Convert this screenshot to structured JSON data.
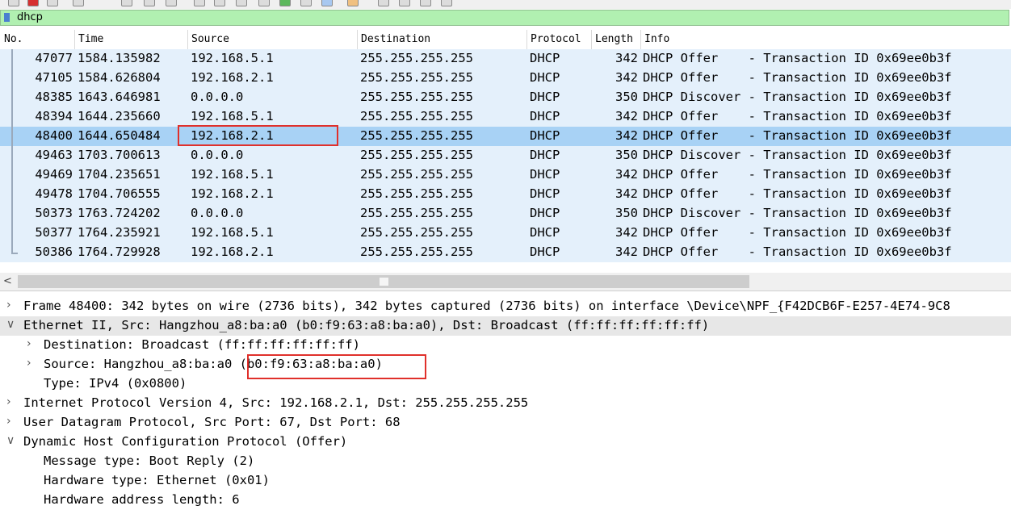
{
  "filter": {
    "value": "dhcp"
  },
  "columns": [
    "No.",
    "Time",
    "Source",
    "Destination",
    "Protocol",
    "Length",
    "Info"
  ],
  "packets": [
    {
      "no": "47077",
      "time": "1584.135982",
      "src": "192.168.5.1",
      "dst": "255.255.255.255",
      "proto": "DHCP",
      "len": "342",
      "info": "DHCP Offer    - Transaction ID 0x69ee0b3f"
    },
    {
      "no": "47105",
      "time": "1584.626804",
      "src": "192.168.2.1",
      "dst": "255.255.255.255",
      "proto": "DHCP",
      "len": "342",
      "info": "DHCP Offer    - Transaction ID 0x69ee0b3f"
    },
    {
      "no": "48385",
      "time": "1643.646981",
      "src": "0.0.0.0",
      "dst": "255.255.255.255",
      "proto": "DHCP",
      "len": "350",
      "info": "DHCP Discover - Transaction ID 0x69ee0b3f"
    },
    {
      "no": "48394",
      "time": "1644.235660",
      "src": "192.168.5.1",
      "dst": "255.255.255.255",
      "proto": "DHCP",
      "len": "342",
      "info": "DHCP Offer    - Transaction ID 0x69ee0b3f"
    },
    {
      "no": "48400",
      "time": "1644.650484",
      "src": "192.168.2.1",
      "dst": "255.255.255.255",
      "proto": "DHCP",
      "len": "342",
      "info": "DHCP Offer    - Transaction ID 0x69ee0b3f"
    },
    {
      "no": "49463",
      "time": "1703.700613",
      "src": "0.0.0.0",
      "dst": "255.255.255.255",
      "proto": "DHCP",
      "len": "350",
      "info": "DHCP Discover - Transaction ID 0x69ee0b3f"
    },
    {
      "no": "49469",
      "time": "1704.235651",
      "src": "192.168.5.1",
      "dst": "255.255.255.255",
      "proto": "DHCP",
      "len": "342",
      "info": "DHCP Offer    - Transaction ID 0x69ee0b3f"
    },
    {
      "no": "49478",
      "time": "1704.706555",
      "src": "192.168.2.1",
      "dst": "255.255.255.255",
      "proto": "DHCP",
      "len": "342",
      "info": "DHCP Offer    - Transaction ID 0x69ee0b3f"
    },
    {
      "no": "50373",
      "time": "1763.724202",
      "src": "0.0.0.0",
      "dst": "255.255.255.255",
      "proto": "DHCP",
      "len": "350",
      "info": "DHCP Discover - Transaction ID 0x69ee0b3f"
    },
    {
      "no": "50377",
      "time": "1764.235921",
      "src": "192.168.5.1",
      "dst": "255.255.255.255",
      "proto": "DHCP",
      "len": "342",
      "info": "DHCP Offer    - Transaction ID 0x69ee0b3f"
    },
    {
      "no": "50386",
      "time": "1764.729928",
      "src": "192.168.2.1",
      "dst": "255.255.255.255",
      "proto": "DHCP",
      "len": "342",
      "info": "DHCP Offer    - Transaction ID 0x69ee0b3f"
    }
  ],
  "details": [
    {
      "text": "Frame 48400: 342 bytes on wire (2736 bits), 342 bytes captured (2736 bits) on interface \\Device\\NPF_{F42DCB6F-E257-4E74-9C8",
      "toggle": ">",
      "level": 0
    },
    {
      "text": "Ethernet II, Src: Hangzhou_a8:ba:a0 (b0:f9:63:a8:ba:a0), Dst: Broadcast (ff:ff:ff:ff:ff:ff)",
      "toggle": "v",
      "level": 0
    },
    {
      "text": "Destination: Broadcast (ff:ff:ff:ff:ff:ff)",
      "toggle": ">",
      "level": 1
    },
    {
      "text": "Source: Hangzhou_a8:ba:a0 (b0:f9:63:a8:ba:a0)",
      "toggle": ">",
      "level": 1
    },
    {
      "text": "Type: IPv4 (0x0800)",
      "toggle": "",
      "level": 1
    },
    {
      "text": "Internet Protocol Version 4, Src: 192.168.2.1, Dst: 255.255.255.255",
      "toggle": ">",
      "level": 0
    },
    {
      "text": "User Datagram Protocol, Src Port: 67, Dst Port: 68",
      "toggle": ">",
      "level": 0
    },
    {
      "text": "Dynamic Host Configuration Protocol (Offer)",
      "toggle": "v",
      "level": 0
    },
    {
      "text": "Message type: Boot Reply (2)",
      "toggle": "",
      "level": 1
    },
    {
      "text": "Hardware type: Ethernet (0x01)",
      "toggle": "",
      "level": 1
    },
    {
      "text": "Hardware address length: 6",
      "toggle": "",
      "level": 1
    }
  ],
  "colors": {
    "row_bg": "#e4f0fb",
    "selected_bg": "#a8d2f5",
    "filter_bg": "#b1f0b1",
    "highlight_box": "#e0302b"
  }
}
